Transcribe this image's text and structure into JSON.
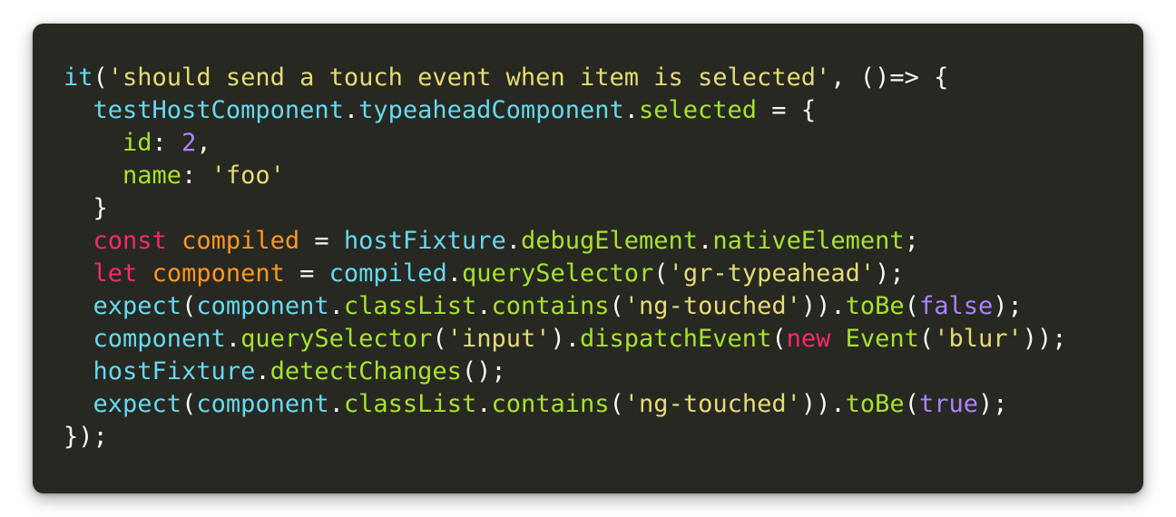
{
  "editor": {
    "lines": [
      [
        {
          "t": "it",
          "k": "fn"
        },
        {
          "t": "(",
          "k": "punct"
        },
        {
          "t": "'should send a touch event when item is selected'",
          "k": "str"
        },
        {
          "t": ", ()=> {",
          "k": "punct"
        }
      ],
      [
        {
          "t": "  ",
          "k": "plain"
        },
        {
          "t": "testHostComponent",
          "k": "fn"
        },
        {
          "t": ".",
          "k": "punct"
        },
        {
          "t": "typeaheadComponent",
          "k": "fn"
        },
        {
          "t": ".",
          "k": "punct"
        },
        {
          "t": "selected",
          "k": "prop"
        },
        {
          "t": " = {",
          "k": "punct"
        }
      ],
      [
        {
          "t": "    ",
          "k": "plain"
        },
        {
          "t": "id",
          "k": "prop"
        },
        {
          "t": ": ",
          "k": "punct"
        },
        {
          "t": "2",
          "k": "num"
        },
        {
          "t": ",",
          "k": "punct"
        }
      ],
      [
        {
          "t": "    ",
          "k": "plain"
        },
        {
          "t": "name",
          "k": "prop"
        },
        {
          "t": ": ",
          "k": "punct"
        },
        {
          "t": "'foo'",
          "k": "str"
        }
      ],
      [
        {
          "t": "  }",
          "k": "punct"
        }
      ],
      [
        {
          "t": "  ",
          "k": "plain"
        },
        {
          "t": "const",
          "k": "kw"
        },
        {
          "t": " ",
          "k": "plain"
        },
        {
          "t": "compiled",
          "k": "var"
        },
        {
          "t": " = ",
          "k": "punct"
        },
        {
          "t": "hostFixture",
          "k": "fn"
        },
        {
          "t": ".",
          "k": "punct"
        },
        {
          "t": "debugElement",
          "k": "prop"
        },
        {
          "t": ".",
          "k": "punct"
        },
        {
          "t": "nativeElement",
          "k": "prop"
        },
        {
          "t": ";",
          "k": "punct"
        }
      ],
      [
        {
          "t": "  ",
          "k": "plain"
        },
        {
          "t": "let",
          "k": "kw"
        },
        {
          "t": " ",
          "k": "plain"
        },
        {
          "t": "component",
          "k": "var"
        },
        {
          "t": " = ",
          "k": "punct"
        },
        {
          "t": "compiled",
          "k": "fn"
        },
        {
          "t": ".",
          "k": "punct"
        },
        {
          "t": "querySelector",
          "k": "prop"
        },
        {
          "t": "(",
          "k": "punct"
        },
        {
          "t": "'gr-typeahead'",
          "k": "str"
        },
        {
          "t": ");",
          "k": "punct"
        }
      ],
      [
        {
          "t": "  ",
          "k": "plain"
        },
        {
          "t": "expect",
          "k": "fn"
        },
        {
          "t": "(",
          "k": "punct"
        },
        {
          "t": "component",
          "k": "fn"
        },
        {
          "t": ".",
          "k": "punct"
        },
        {
          "t": "classList",
          "k": "prop"
        },
        {
          "t": ".",
          "k": "punct"
        },
        {
          "t": "contains",
          "k": "prop"
        },
        {
          "t": "(",
          "k": "punct"
        },
        {
          "t": "'ng-touched'",
          "k": "str"
        },
        {
          "t": ")).",
          "k": "punct"
        },
        {
          "t": "toBe",
          "k": "prop"
        },
        {
          "t": "(",
          "k": "punct"
        },
        {
          "t": "false",
          "k": "num"
        },
        {
          "t": ");",
          "k": "punct"
        }
      ],
      [
        {
          "t": "  ",
          "k": "plain"
        },
        {
          "t": "component",
          "k": "fn"
        },
        {
          "t": ".",
          "k": "punct"
        },
        {
          "t": "querySelector",
          "k": "prop"
        },
        {
          "t": "(",
          "k": "punct"
        },
        {
          "t": "'input'",
          "k": "str"
        },
        {
          "t": ").",
          "k": "punct"
        },
        {
          "t": "dispatchEvent",
          "k": "prop"
        },
        {
          "t": "(",
          "k": "punct"
        },
        {
          "t": "new",
          "k": "kw"
        },
        {
          "t": " ",
          "k": "plain"
        },
        {
          "t": "Event",
          "k": "prop"
        },
        {
          "t": "(",
          "k": "punct"
        },
        {
          "t": "'blur'",
          "k": "str"
        },
        {
          "t": "));",
          "k": "punct"
        }
      ],
      [
        {
          "t": "  ",
          "k": "plain"
        },
        {
          "t": "hostFixture",
          "k": "fn"
        },
        {
          "t": ".",
          "k": "punct"
        },
        {
          "t": "detectChanges",
          "k": "prop"
        },
        {
          "t": "();",
          "k": "punct"
        }
      ],
      [
        {
          "t": "  ",
          "k": "plain"
        },
        {
          "t": "expect",
          "k": "fn"
        },
        {
          "t": "(",
          "k": "punct"
        },
        {
          "t": "component",
          "k": "fn"
        },
        {
          "t": ".",
          "k": "punct"
        },
        {
          "t": "classList",
          "k": "prop"
        },
        {
          "t": ".",
          "k": "punct"
        },
        {
          "t": "contains",
          "k": "prop"
        },
        {
          "t": "(",
          "k": "punct"
        },
        {
          "t": "'ng-touched'",
          "k": "str"
        },
        {
          "t": ")).",
          "k": "punct"
        },
        {
          "t": "toBe",
          "k": "prop"
        },
        {
          "t": "(",
          "k": "punct"
        },
        {
          "t": "true",
          "k": "num"
        },
        {
          "t": ");",
          "k": "punct"
        }
      ],
      [
        {
          "t": "});",
          "k": "punct"
        }
      ]
    ]
  },
  "theme": {
    "background": "#272822",
    "text": "#f8f8f2",
    "function": "#66d9ef",
    "property": "#a6e22e",
    "string": "#e6db74",
    "number": "#ae81ff",
    "keyword": "#f92672",
    "variable": "#fd971f"
  }
}
